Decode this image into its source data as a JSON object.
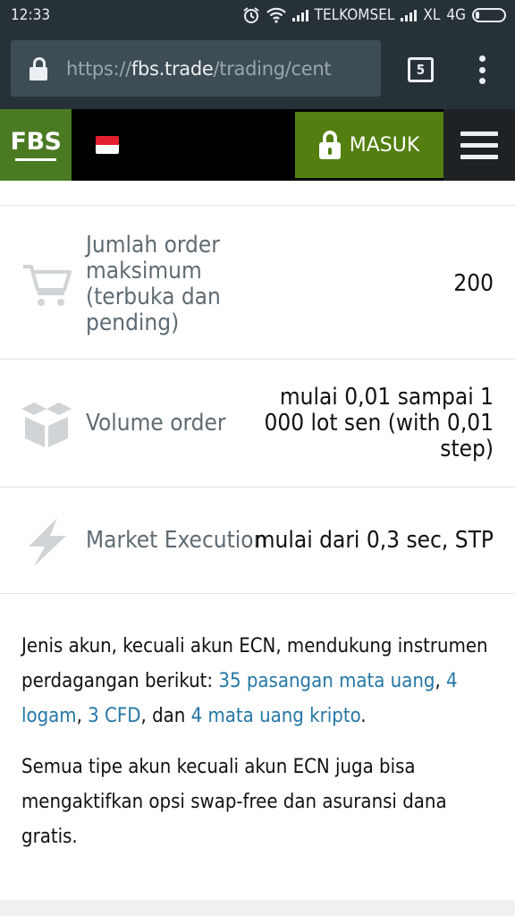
{
  "status_bar": {
    "time": "12:33",
    "carrier1": "TELKOMSEL",
    "carrier2": "XL",
    "network": "4G"
  },
  "browser": {
    "url_scheme": "https://",
    "url_host": "fbs.trade",
    "url_path": "/trading/cent",
    "tab_count": "5"
  },
  "header": {
    "logo_text": "FBS",
    "login_label": "MASUK",
    "colors": {
      "logo_bg": "#4a7a22",
      "login_bg": "#527f0f"
    }
  },
  "features": [
    {
      "icon": "shopping-cart-icon",
      "label": "Jumlah order maksimum (terbuka dan pending)",
      "value": "200"
    },
    {
      "icon": "boxes-icon",
      "label": "Volume order",
      "value": "mulai 0,01 sampai 1 000 lot sen (with 0,01 step)"
    },
    {
      "icon": "lightning-icon",
      "label": "Market Execution",
      "value": "mulai dari 0,3 sec, STP"
    }
  ],
  "info": {
    "p1_lead": "Jenis akun, kecuali akun ECN, mendukung instrumen perdagangan berikut: ",
    "p1_link1": "35 pasangan mata uang",
    "p1_sep1": ", ",
    "p1_link2": "4 logam",
    "p1_sep2": ", ",
    "p1_link3": "3 CFD",
    "p1_sep3": ", dan ",
    "p1_link4": "4 mata uang kripto",
    "p1_end": ".",
    "p2": "Semua tipe akun kecuali akun ECN juga bisa mengaktifkan opsi swap-free dan asuransi dana gratis.",
    "link_color": "#2577a6"
  }
}
